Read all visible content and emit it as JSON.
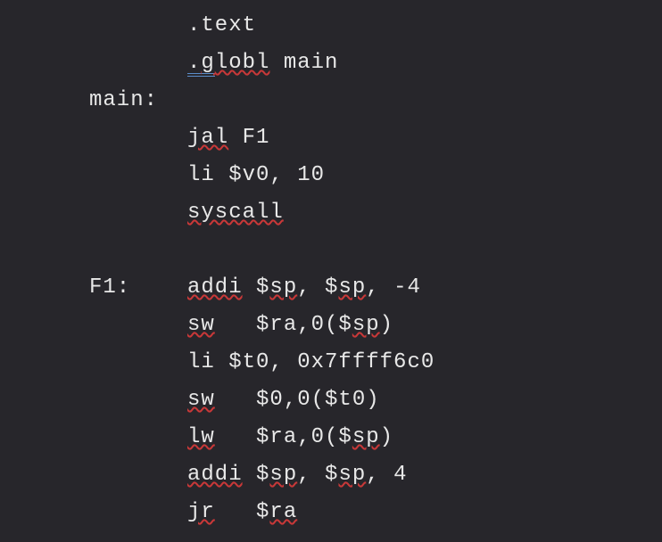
{
  "code": {
    "line1_text": ".text",
    "line2_globl_dot": ".",
    "line2_globl_g": "g",
    "line2_globl_lobl": "lobl",
    "line2_main": " main",
    "line3_label": "main:",
    "line4_jal": "jal",
    "line4_f1": " F1",
    "line5": "li $v0, 10",
    "line6_syscall": "syscall",
    "line7_label": "F1:",
    "line7_addi": "addi",
    "line7_mid1": " $",
    "line7_sp1": "sp",
    "line7_mid2": ", $",
    "line7_sp2": "sp",
    "line7_end": ", -4",
    "line8_sw": "sw",
    "line8_mid": "   $ra,0($",
    "line8_sp": "sp",
    "line8_end": ")",
    "line9": "li $t0, 0x7ffff6c0",
    "line10_sw": "sw",
    "line10_end": "   $0,0($t0)",
    "line11_lw": "lw",
    "line11_mid": "   $ra,0($",
    "line11_sp": "sp",
    "line11_end": ")",
    "line12_addi": "addi",
    "line12_mid1": " $",
    "line12_sp1": "sp",
    "line12_mid2": ", $",
    "line12_sp2": "sp",
    "line12_end": ", 4",
    "line13_jr": "jr",
    "line13_mid": "   $",
    "line13_ra": "ra"
  }
}
